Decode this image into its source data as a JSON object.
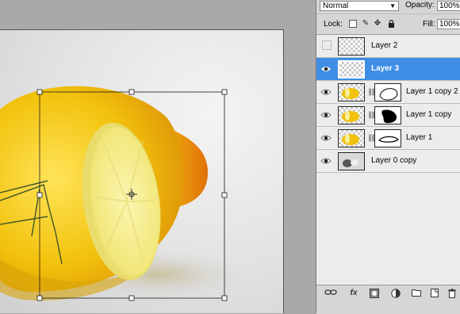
{
  "panel": {
    "blend_mode": "Normal",
    "opacity_label": "Opacity:",
    "opacity_value": "100%",
    "lock_label": "Lock:",
    "fill_label": "Fill:",
    "fill_value": "100%"
  },
  "layers": [
    {
      "name": "Layer 2",
      "visible": false,
      "selected": false,
      "has_mask": false
    },
    {
      "name": "Layer 3",
      "visible": true,
      "selected": true,
      "has_mask": false
    },
    {
      "name": "Layer 1 copy 2",
      "visible": true,
      "selected": false,
      "has_mask": true
    },
    {
      "name": "Layer 1 copy",
      "visible": true,
      "selected": false,
      "has_mask": true
    },
    {
      "name": "Layer 1",
      "visible": true,
      "selected": false,
      "has_mask": true
    },
    {
      "name": "Layer 0 copy",
      "visible": true,
      "selected": false,
      "has_mask": false
    }
  ],
  "bottom_icons": [
    "link-layers-icon",
    "fx-icon",
    "add-mask-icon",
    "adjustment-layer-icon",
    "new-group-icon",
    "new-layer-icon",
    "delete-layer-icon"
  ],
  "bottom_icon_labels": {
    "fx": "fx"
  },
  "colors": {
    "selection": "#3f8ee6",
    "lemon_yellow": "#f4c414",
    "lemon_orange": "#e98a10"
  }
}
